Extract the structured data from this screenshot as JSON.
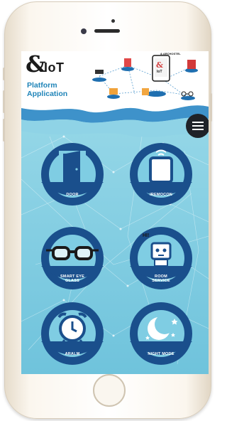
{
  "app": {
    "brand_symbol": "&",
    "brand_name": "IoT",
    "subtitle_line1": "Platform",
    "subtitle_line2": "Application",
    "hero_small_text": "& ARCHOSTEL",
    "hero_device_label": "IoT"
  },
  "colors": {
    "navy": "#1a4f8c",
    "light_blue": "#7fcde3",
    "hero_blue": "#2f86c4",
    "menu_dark": "#1f2228"
  },
  "menu": {
    "icon": "hamburger-menu-icon"
  },
  "tiles": [
    {
      "label": "DOOR",
      "icon": "door-icon"
    },
    {
      "label": "IREMOCON",
      "icon": "remote-control-icon"
    },
    {
      "label_line1": "SMART EYE",
      "label_line2": "GLASS",
      "icon": "smart-glasses-icon"
    },
    {
      "label_line1": "ROOM",
      "label_line2": "SERVICE",
      "icon": "robot-icon",
      "badge": "HI!"
    },
    {
      "label": "ARALM",
      "icon": "alarm-clock-icon"
    },
    {
      "label": "NIGHT MODE",
      "icon": "moon-stars-icon"
    }
  ]
}
